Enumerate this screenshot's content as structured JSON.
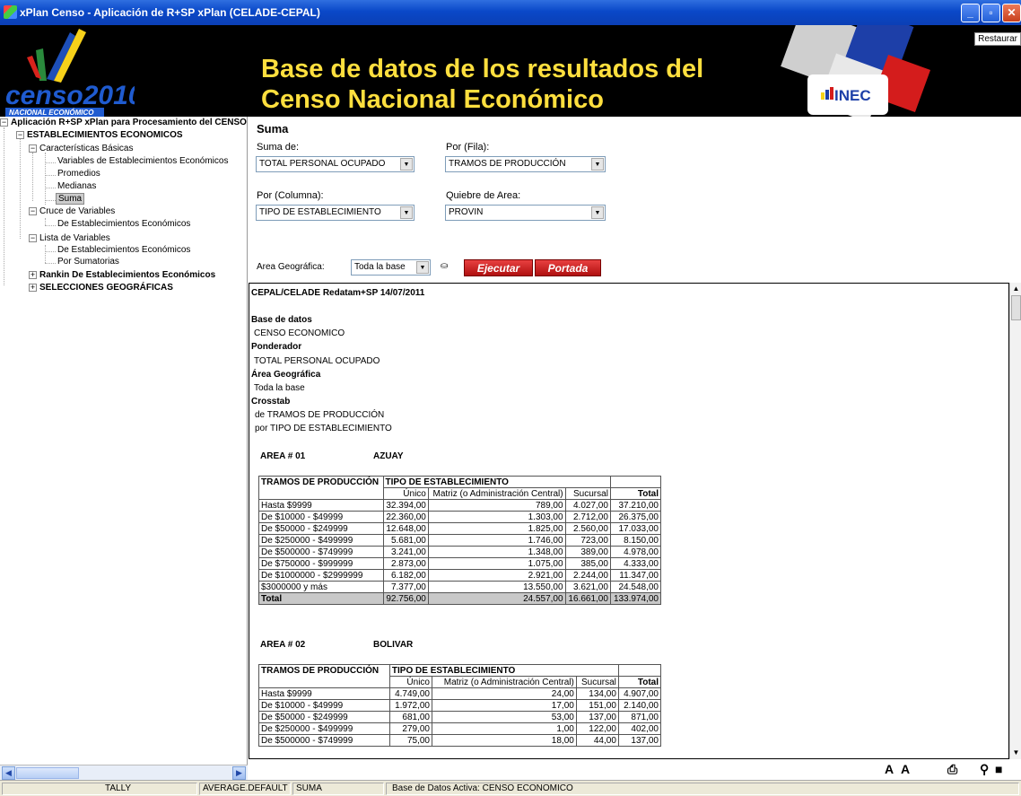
{
  "window": {
    "title": "xPlan Censo - Aplicación de R+SP xPlan (CELADE-CEPAL)",
    "restaurar": "Restaurar"
  },
  "banner": {
    "logo_text": "censo2010",
    "logo_sub": "NACIONAL ECONÓMICO",
    "title_line1": "Base de datos de los resultados del",
    "title_line2": "Censo Nacional Económico",
    "inec": "INEC"
  },
  "tree": {
    "root": "Aplicación R+SP xPlan para Procesamiento del CENSO",
    "establecimientos": "ESTABLECIMIENTOS ECONOMICOS",
    "caracteristicas": "Características Básicas",
    "variables": "Variables de Establecimientos Económicos",
    "promedios": "Promedios",
    "medianas": "Medianas",
    "suma": "Suma",
    "cruce": "Cruce de Variables",
    "cruce_est": "De Establecimientos Económicos",
    "lista": "Lista de Variables",
    "lista_est": "De Establecimientos Económicos",
    "sumatorias": "Por Sumatorias",
    "rankin": "Rankin De Establecimientos Económicos",
    "selecciones": "SELECCIONES GEOGRÁFICAS"
  },
  "form": {
    "heading": "Suma",
    "suma_de_label": "Suma de:",
    "suma_de_value": "TOTAL PERSONAL OCUPADO",
    "fila_label": "Por (Fila):",
    "fila_value": "TRAMOS DE PRODUCCIÓN",
    "columna_label": "Por (Columna):",
    "columna_value": "TIPO DE ESTABLECIMIENTO",
    "quiebre_label": "Quiebre de Area:",
    "quiebre_value": "PROVIN",
    "area_label": "Area Geográfica:",
    "area_value": "Toda la base",
    "ejecutar": "Ejecutar",
    "portada": "Portada"
  },
  "report": {
    "header": "CEPAL/CELADE Redatam+SP 14/07/2011",
    "base_label": "Base de datos",
    "base_value": "CENSO ECONOMICO",
    "pond_label": "Ponderador",
    "pond_value": "TOTAL PERSONAL OCUPADO",
    "area_label": "Área Geográfica",
    "area_value": "Toda la base",
    "cross_label": "Crosstab",
    "cross_rows": "de TRAMOS DE PRODUCCIÓN",
    "cross_cols": "por TIPO DE ESTABLECIMIENTO",
    "col_header_row": "TRAMOS DE PRODUCCIÓN",
    "col_header_group": "TIPO DE ESTABLECIMIENTO",
    "columns": [
      "Único",
      "Matriz (o Administración Central)",
      "Sucursal",
      "Total"
    ],
    "areas": [
      {
        "label": "AREA # 01",
        "name": "AZUAY",
        "rows": [
          [
            "Hasta $9999",
            "32.394,00",
            "789,00",
            "4.027,00",
            "37.210,00"
          ],
          [
            "De $10000 - $49999",
            "22.360,00",
            "1.303,00",
            "2.712,00",
            "26.375,00"
          ],
          [
            "De $50000 - $249999",
            "12.648,00",
            "1.825,00",
            "2.560,00",
            "17.033,00"
          ],
          [
            "De $250000 - $499999",
            "5.681,00",
            "1.746,00",
            "723,00",
            "8.150,00"
          ],
          [
            "De $500000 - $749999",
            "3.241,00",
            "1.348,00",
            "389,00",
            "4.978,00"
          ],
          [
            "De $750000 - $999999",
            "2.873,00",
            "1.075,00",
            "385,00",
            "4.333,00"
          ],
          [
            "De $1000000 - $2999999",
            "6.182,00",
            "2.921,00",
            "2.244,00",
            "11.347,00"
          ],
          [
            "$3000000 y más",
            "7.377,00",
            "13.550,00",
            "3.621,00",
            "24.548,00"
          ]
        ],
        "total": [
          "Total",
          "92.756,00",
          "24.557,00",
          "16.661,00",
          "133.974,00"
        ]
      },
      {
        "label": "AREA # 02",
        "name": "BOLIVAR",
        "rows": [
          [
            "Hasta $9999",
            "4.749,00",
            "24,00",
            "134,00",
            "4.907,00"
          ],
          [
            "De $10000 - $49999",
            "1.972,00",
            "17,00",
            "151,00",
            "2.140,00"
          ],
          [
            "De $50000 - $249999",
            "681,00",
            "53,00",
            "137,00",
            "871,00"
          ],
          [
            "De $250000 - $499999",
            "279,00",
            "1,00",
            "122,00",
            "402,00"
          ],
          [
            "De $500000 - $749999",
            "75,00",
            "18,00",
            "44,00",
            "137,00"
          ]
        ]
      }
    ]
  },
  "status": {
    "p1": "TALLY",
    "p2": "AVERAGE.DEFAULT",
    "p3": "SUMA",
    "p4": "Base de Datos Activa: CENSO ECONOMICO"
  },
  "colors": {
    "banner_title": "#ffdf3e",
    "titlebar": "#0a48c8",
    "button_red": "#c01818"
  }
}
